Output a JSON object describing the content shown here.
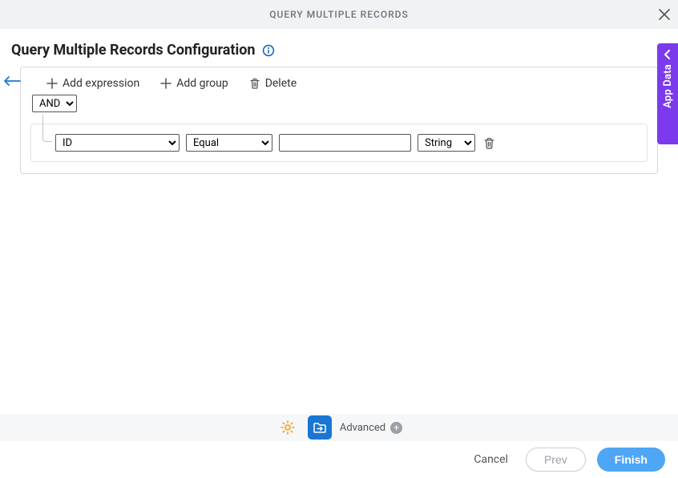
{
  "header": {
    "title": "QUERY MULTIPLE RECORDS"
  },
  "page": {
    "title": "Query Multiple Records Configuration"
  },
  "toolbar": {
    "add_expression": "Add expression",
    "add_group": "Add group",
    "delete": "Delete"
  },
  "logic": {
    "selected": "AND"
  },
  "expression": {
    "field": "ID",
    "operator": "Equal",
    "value": "",
    "type": "String"
  },
  "side_panel": {
    "label": "App Data"
  },
  "bottom": {
    "advanced": "Advanced"
  },
  "footer": {
    "cancel": "Cancel",
    "prev": "Prev",
    "finish": "Finish"
  }
}
